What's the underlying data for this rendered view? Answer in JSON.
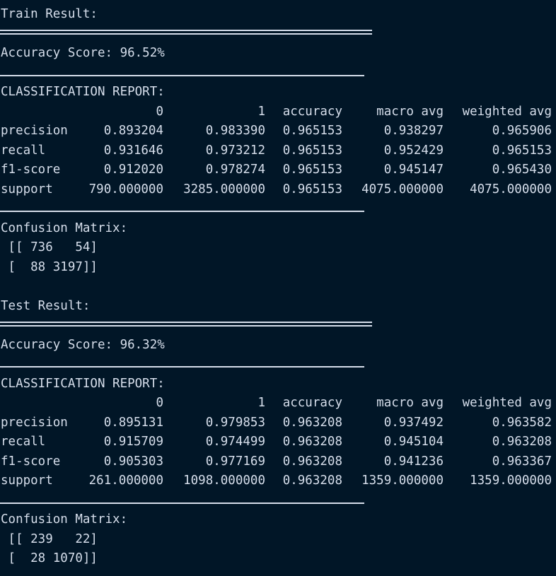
{
  "results": [
    {
      "title": "Train Result:",
      "accuracy_line": "Accuracy Score: 96.52%",
      "report_title": "CLASSIFICATION REPORT:",
      "columns": [
        "0",
        "1",
        "accuracy",
        "macro avg",
        "weighted avg"
      ],
      "rows": [
        {
          "label": "precision",
          "values": [
            "0.893204",
            "0.983390",
            "0.965153",
            "0.938297",
            "0.965906"
          ]
        },
        {
          "label": "recall",
          "values": [
            "0.931646",
            "0.973212",
            "0.965153",
            "0.952429",
            "0.965153"
          ]
        },
        {
          "label": "f1-score",
          "values": [
            "0.912020",
            "0.978274",
            "0.965153",
            "0.945147",
            "0.965430"
          ]
        },
        {
          "label": "support",
          "values": [
            "790.000000",
            "3285.000000",
            "0.965153",
            "4075.000000",
            "4075.000000"
          ]
        }
      ],
      "confusion_title": "Confusion Matrix:",
      "confusion_lines": [
        " [[ 736   54]",
        " [  88 3197]]"
      ]
    },
    {
      "title": "Test Result:",
      "accuracy_line": "Accuracy Score: 96.32%",
      "report_title": "CLASSIFICATION REPORT:",
      "columns": [
        "0",
        "1",
        "accuracy",
        "macro avg",
        "weighted avg"
      ],
      "rows": [
        {
          "label": "precision",
          "values": [
            "0.895131",
            "0.979853",
            "0.963208",
            "0.937492",
            "0.963582"
          ]
        },
        {
          "label": "recall",
          "values": [
            "0.915709",
            "0.974499",
            "0.963208",
            "0.945104",
            "0.963208"
          ]
        },
        {
          "label": "f1-score",
          "values": [
            "0.905303",
            "0.977169",
            "0.963208",
            "0.941236",
            "0.963367"
          ]
        },
        {
          "label": "support",
          "values": [
            "261.000000",
            "1098.000000",
            "0.963208",
            "1359.000000",
            "1359.000000"
          ]
        }
      ],
      "confusion_title": "Confusion Matrix:",
      "confusion_lines": [
        " [[ 239   22]",
        " [  28 1070]]"
      ]
    }
  ],
  "colors": {
    "background": "#011627",
    "text": "#d6deeb"
  }
}
